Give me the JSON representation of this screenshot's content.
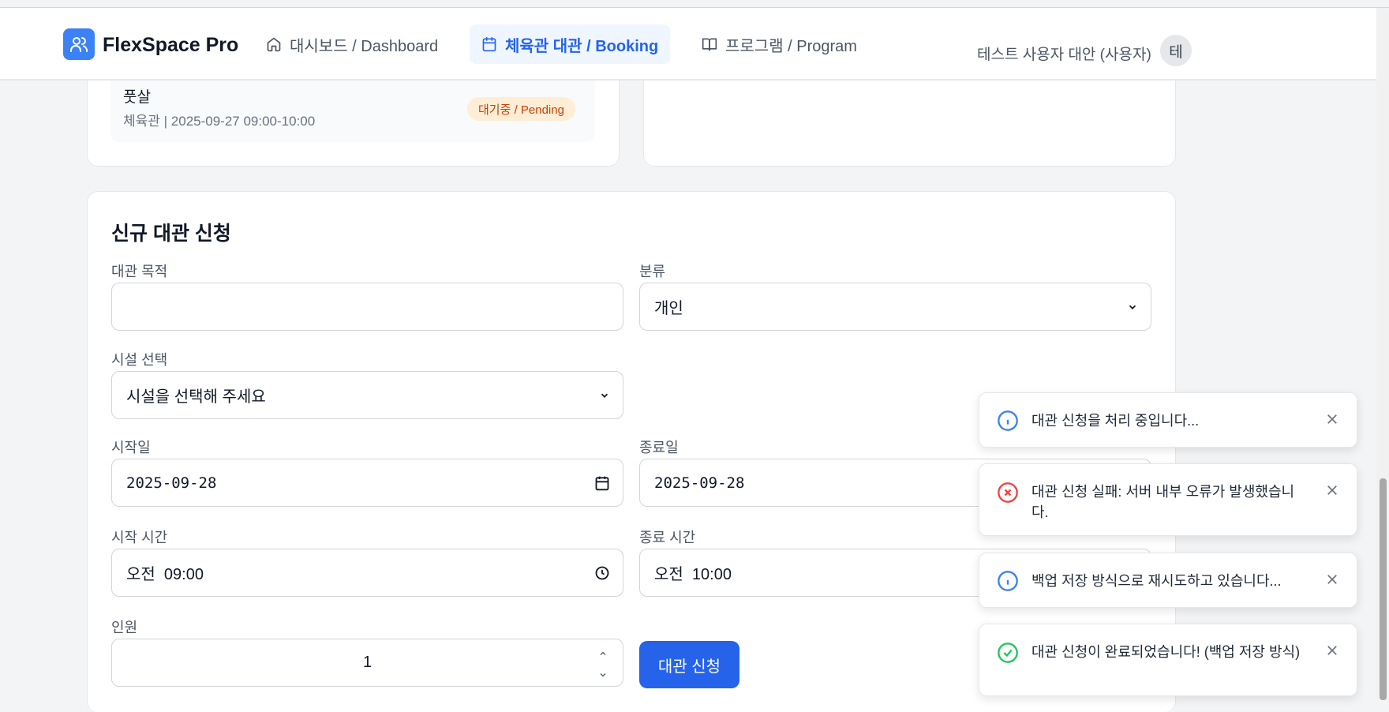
{
  "header": {
    "brand": "FlexSpace Pro",
    "nav": [
      {
        "label": "대시보드 / Dashboard",
        "icon": "home-icon"
      },
      {
        "label": "체육관 대관 / Booking",
        "icon": "calendar-icon",
        "active": true
      },
      {
        "label": "프로그램 / Program",
        "icon": "book-icon"
      }
    ],
    "user_name": "테스트 사용자 대안 (사용자)",
    "avatar_initial": "테"
  },
  "recent_booking": {
    "title": "풋살",
    "subtitle": "체육관 | 2025-09-27 09:00-10:00",
    "status": "대기중 / Pending"
  },
  "form": {
    "title": "신규 대관 신청",
    "purpose_label": "대관 목적",
    "purpose_value": "",
    "category_label": "분류",
    "category_value": "개인",
    "facility_label": "시설 선택",
    "facility_value": "시설을 선택해 주세요",
    "start_date_label": "시작일",
    "start_date_value": "2025-09-28",
    "end_date_label": "종료일",
    "end_date_value": "2025-09-28",
    "start_time_label": "시작 시간",
    "start_time_value": "오전  09:00",
    "end_time_label": "종료 시간",
    "end_time_value": "오전  10:00",
    "people_label": "인원",
    "people_value": "1",
    "submit_label": "대관 신청"
  },
  "toasts": [
    {
      "type": "info",
      "message": "대관 신청을 처리 중입니다..."
    },
    {
      "type": "error",
      "message": "대관 신청 실패: 서버 내부 오류가 발생했습니다."
    },
    {
      "type": "info",
      "message": "백업 저장 방식으로 재시도하고 있습니다..."
    },
    {
      "type": "success",
      "message": "대관 신청이 완료되었습니다! (백업 저장 방식)"
    }
  ],
  "colors": {
    "accent": "#2563eb",
    "info": "#3b82f6",
    "error": "#ef4444",
    "success": "#22c55e",
    "pending_bg": "#ffedd5",
    "pending_text": "#c2410c"
  }
}
